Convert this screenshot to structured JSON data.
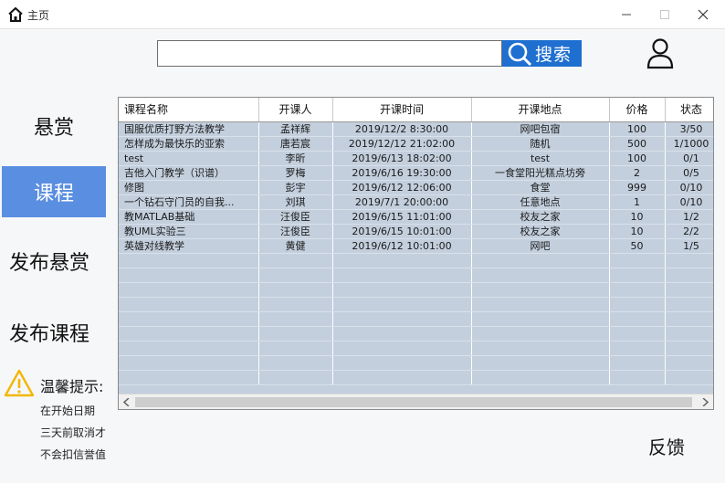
{
  "window": {
    "title": "主页"
  },
  "search": {
    "placeholder": "",
    "value": "",
    "button_label": "搜索"
  },
  "nav": {
    "items": [
      {
        "label": "悬赏",
        "active": false
      },
      {
        "label": "课程",
        "active": true
      },
      {
        "label": "发布悬赏",
        "active": false
      },
      {
        "label": "发布课程",
        "active": false
      }
    ]
  },
  "tip": {
    "title": "温馨提示:",
    "lines": [
      "在开始日期",
      "三天前取消才",
      "不会扣信誉值"
    ]
  },
  "feedback_label": "反馈",
  "table": {
    "columns": [
      "课程名称",
      "开课人",
      "开课时间",
      "开课地点",
      "价格",
      "状态"
    ],
    "rows": [
      [
        "国服优质打野方法教学",
        "孟祥辉",
        "2019/12/2 8:30:00",
        "网吧包宿",
        "100",
        "3/50"
      ],
      [
        "怎样成为最快乐的亚索",
        "唐若宸",
        "2019/12/12 21:02:00",
        "随机",
        "500",
        "1/1000"
      ],
      [
        "test",
        "李昕",
        "2019/6/13 18:02:00",
        "test",
        "100",
        "0/1"
      ],
      [
        "吉他入门教学（识谱）",
        "罗梅",
        "2019/6/16 19:30:00",
        "一食堂阳光糕点坊旁",
        "2",
        "0/5"
      ],
      [
        "修图",
        "彭宇",
        "2019/6/12 12:06:00",
        "食堂",
        "999",
        "0/10"
      ],
      [
        "一个钻石守门员的自我...",
        "刘琪",
        "2019/7/1 20:00:00",
        "任意地点",
        "1",
        "0/10"
      ],
      [
        "教MATLAB基础",
        "汪俊臣",
        "2019/6/15 11:01:00",
        "校友之家",
        "10",
        "1/2"
      ],
      [
        "教UML实验三",
        "汪俊臣",
        "2019/6/15 10:01:00",
        "校友之家",
        "10",
        "2/2"
      ],
      [
        "英雄对线教学",
        "黄健",
        "2019/6/12 10:01:00",
        "网吧",
        "50",
        "1/5"
      ]
    ],
    "empty_rows": 9
  },
  "colors": {
    "accent": "#1f6fd0",
    "nav_active": "#5a8ee0",
    "grid_fill": "#c3cfdd",
    "warning": "#f2b705"
  },
  "icons": {
    "app": "home-icon",
    "search": "search-icon",
    "user": "user-icon",
    "warning": "warning-icon"
  }
}
